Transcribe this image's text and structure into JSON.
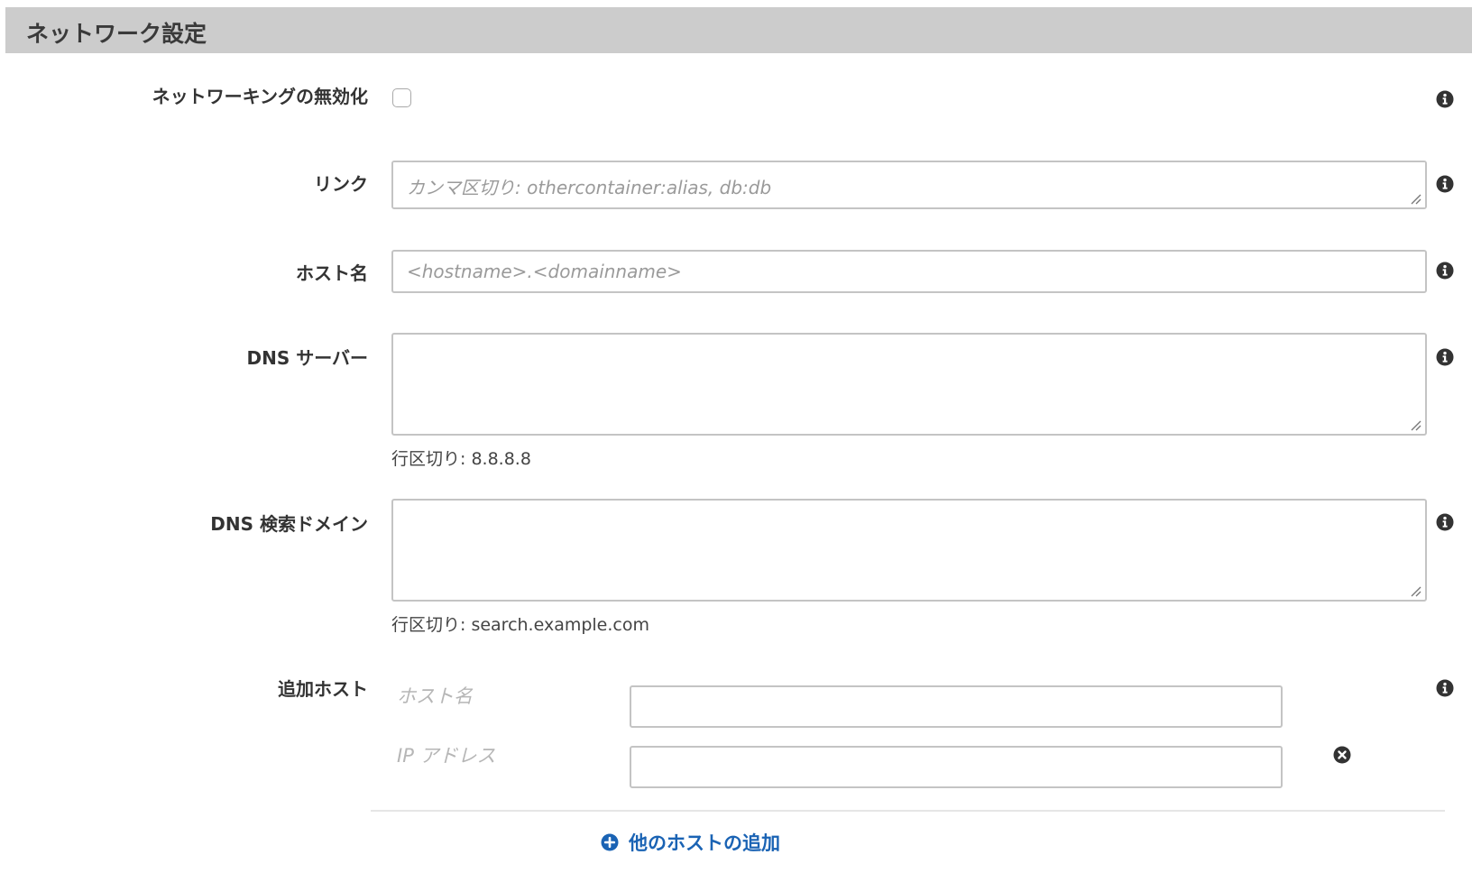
{
  "section": {
    "title": "ネットワーク設定"
  },
  "fields": {
    "disable_networking": {
      "label": "ネットワーキングの無効化",
      "checked": false
    },
    "links": {
      "label": "リンク",
      "placeholder": "カンマ区切り: othercontainer:alias, db:db",
      "value": ""
    },
    "hostname": {
      "label": "ホスト名",
      "placeholder": "<hostname>.<domainname>",
      "value": ""
    },
    "dns_servers": {
      "label": "DNS サーバー",
      "value": "",
      "hint": "行区切り: 8.8.8.8"
    },
    "dns_search_domains": {
      "label": "DNS 検索ドメイン",
      "value": "",
      "hint": "行区切り: search.example.com"
    },
    "extra_hosts": {
      "label": "追加ホスト",
      "hostname_label": "ホスト名",
      "ip_label": "IP アドレス",
      "hostname_value": "",
      "ip_value": "",
      "add_label": "他のホストの追加"
    }
  },
  "icons": {
    "info": "info-icon",
    "remove": "remove-icon",
    "add": "plus-circle-icon"
  },
  "colors": {
    "header_bg": "#cccccc",
    "link": "#1a63b4",
    "border": "#c4c4c4",
    "icon": "#333333"
  }
}
